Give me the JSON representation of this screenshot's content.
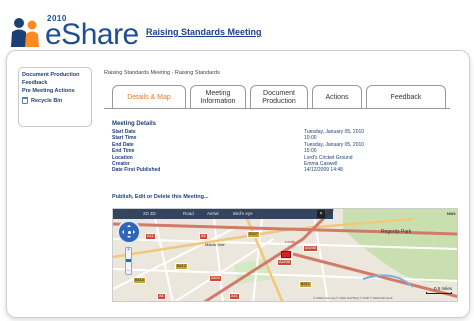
{
  "header": {
    "logo_version": "2010",
    "logo_text": "eShare",
    "page_heading": "Raising Standards Meeting"
  },
  "sidebar": {
    "items": [
      {
        "label": "Document Production"
      },
      {
        "label": "Feedback"
      },
      {
        "label": "Pre Meeting Actions"
      }
    ],
    "recycle_label": "Recycle Bin"
  },
  "breadcrumb": "Raising Standards Meeting - Raising Standards",
  "tabs": [
    {
      "label": "Details & Map",
      "active": true
    },
    {
      "label": "Meeting Information",
      "active": false
    },
    {
      "label": "Document Production",
      "active": false
    },
    {
      "label": "Actions",
      "active": false
    },
    {
      "label": "Feedback",
      "active": false
    }
  ],
  "details": {
    "title": "Meeting Details",
    "rows": [
      {
        "key": "Start Date",
        "value": "Tuesday, January 05, 2010"
      },
      {
        "key": "Start Time",
        "value": "10:00"
      },
      {
        "key": "End Date",
        "value": "Tuesday, January 05, 2010"
      },
      {
        "key": "End Time",
        "value": "15:00"
      },
      {
        "key": "Location",
        "value": "Lord's Cricket Ground"
      },
      {
        "key": "Creator",
        "value": "Emma Caswell"
      },
      {
        "key": "Date First Published",
        "value": "14/12/2009 14:48"
      }
    ],
    "publish_link": "Publish, Edit or Delete this Meeting..."
  },
  "map": {
    "toolbar": {
      "zoom_text": "2D  3D",
      "road": "Road",
      "aerial": "Aerial",
      "birds_eye": "Bird's eye",
      "close": "×"
    },
    "labels": {
      "maida_vale": "Maida Vale",
      "regents_park": "Regents Park",
      "lords": "Lords",
      "nw1": "NW1"
    },
    "roads": {
      "a5": "A5",
      "b507": "B507",
      "a41": "A41",
      "a5205": "A5205",
      "a4206": "A4206",
      "b413": "B413",
      "b412": "B412",
      "a404": "A404",
      "a5b": "A5",
      "b411": "B411",
      "a41b": "A41"
    },
    "scale_label": "0.5 miles",
    "copyright": "© 2009 Intermap  © 2009 NAVTEQ  © AND  © 2009 Microsoft"
  },
  "colors": {
    "brand_blue": "#1f4f8f",
    "link_blue": "#1f3f7a",
    "active_tab": "#e07a2e",
    "map_marker": "#d8201f"
  }
}
